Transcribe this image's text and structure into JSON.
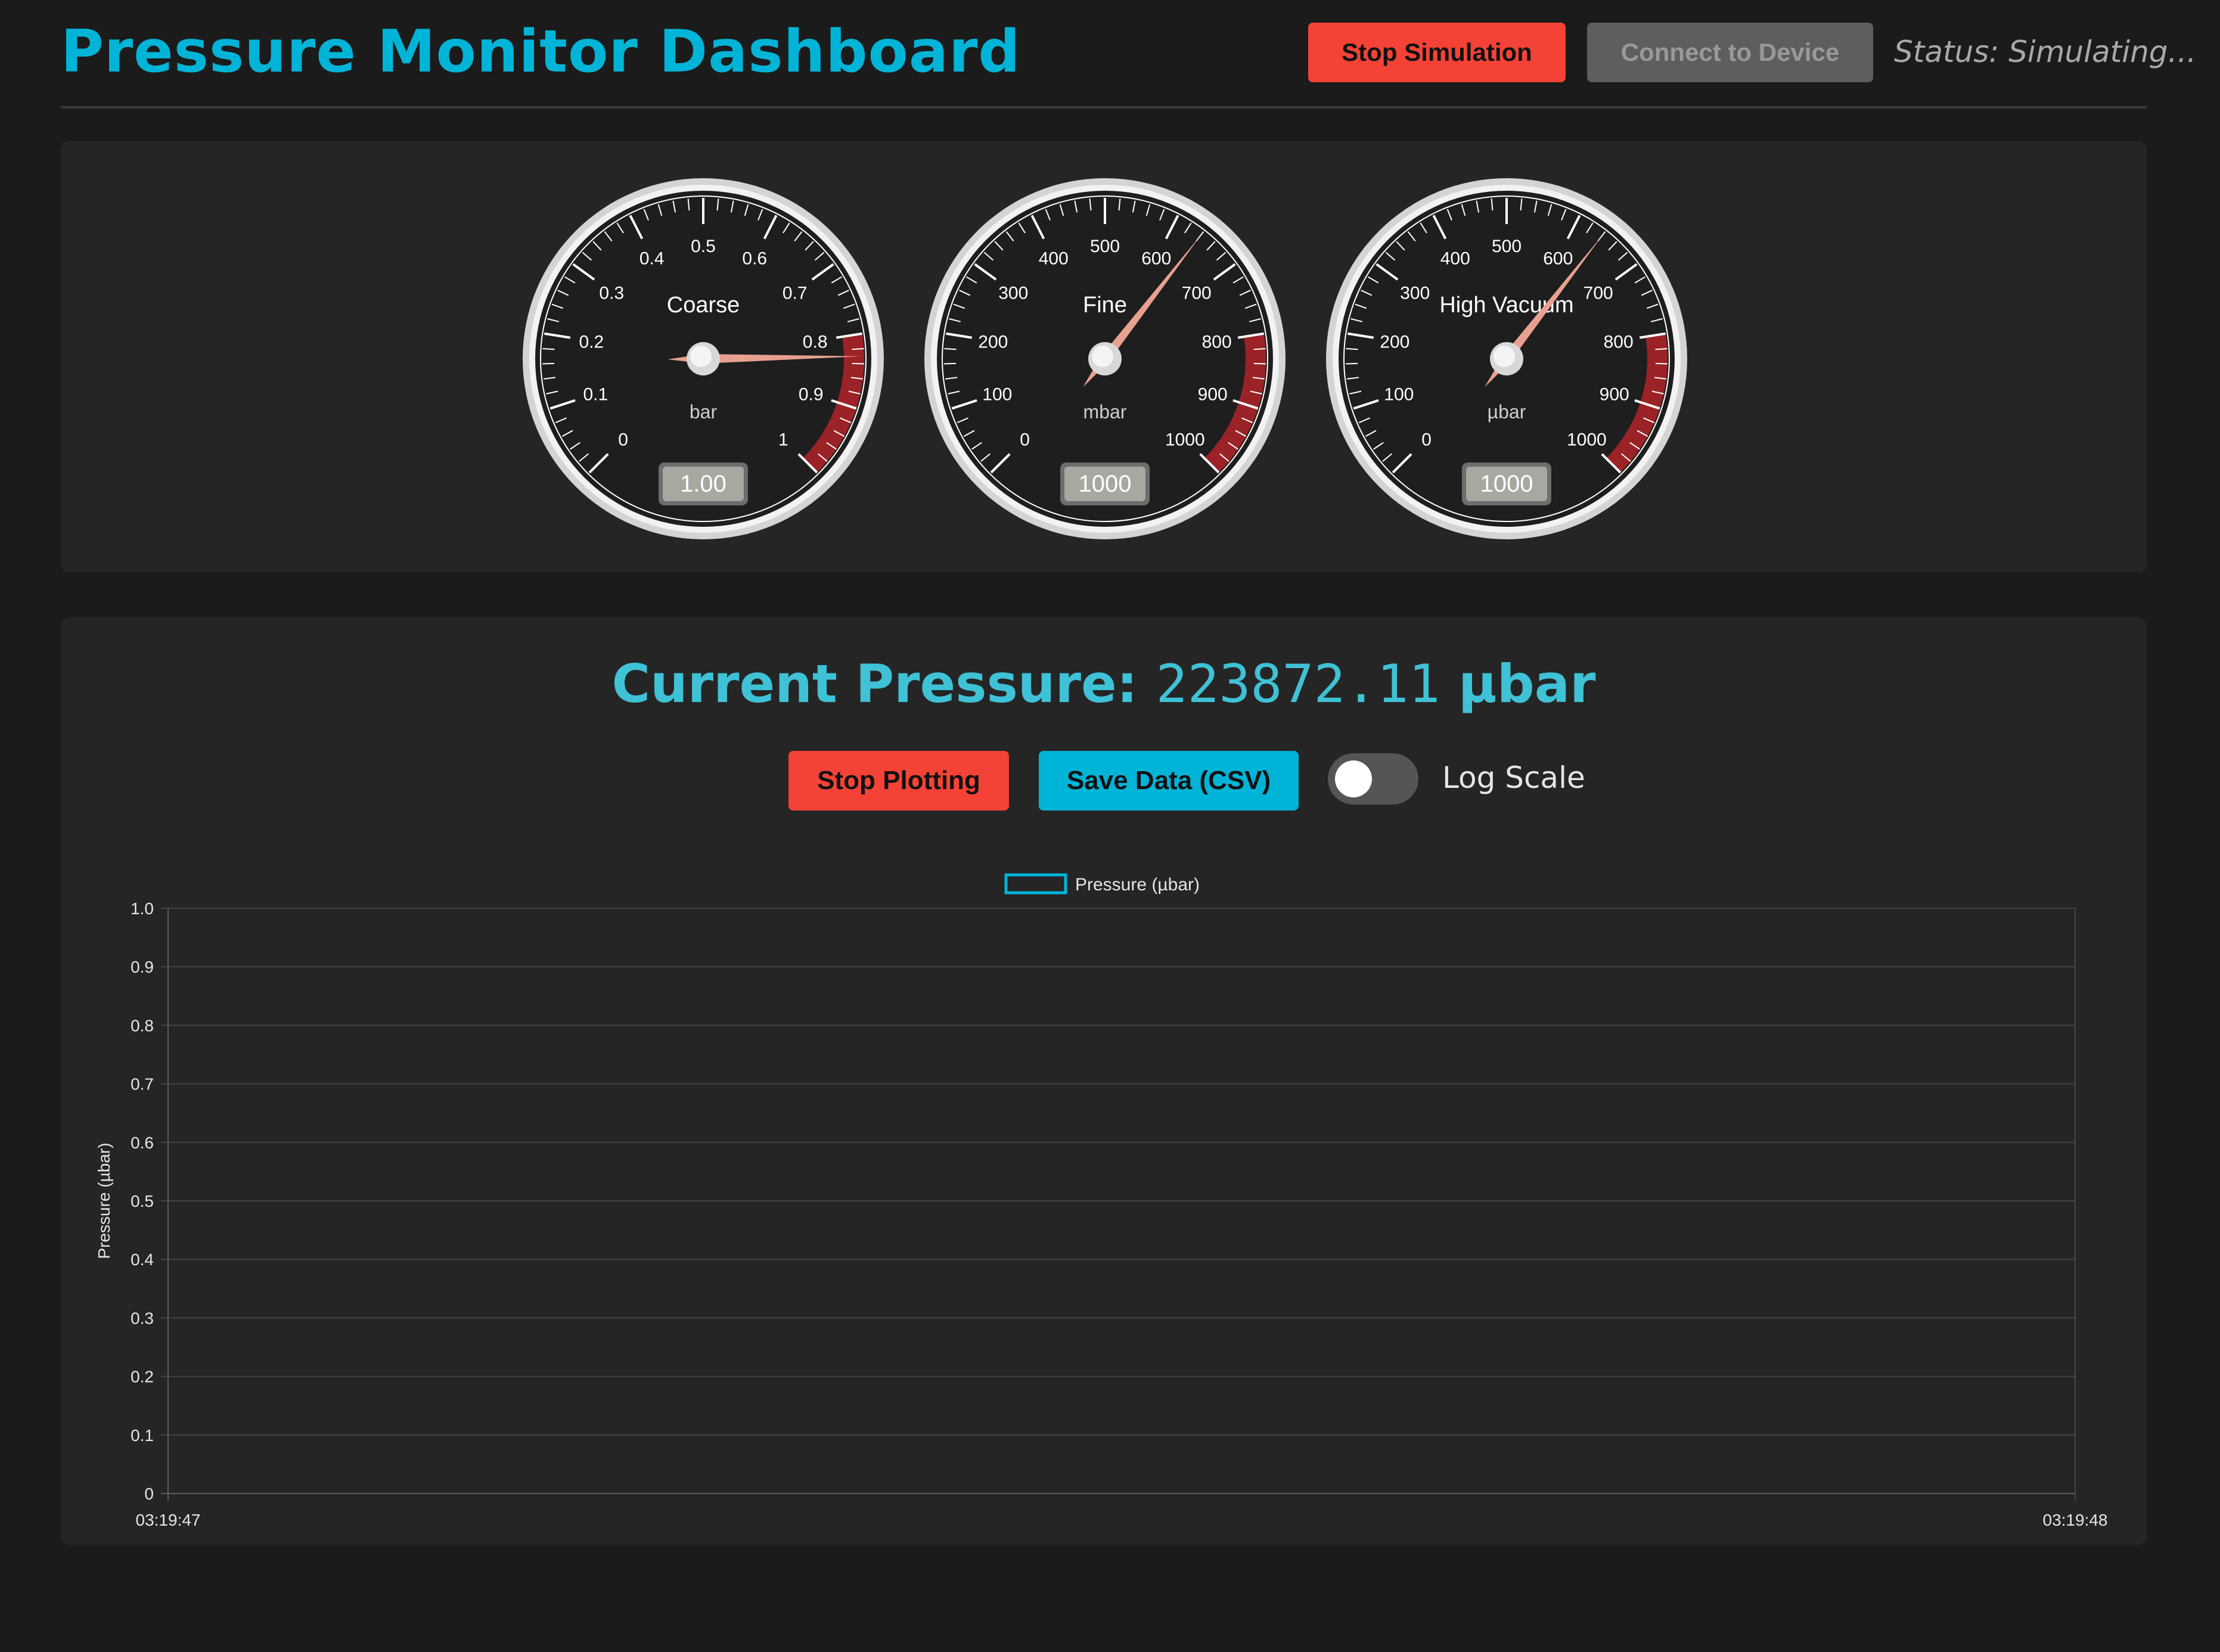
{
  "header": {
    "title": "Pressure Monitor Dashboard",
    "stop_simulation_label": "Stop Simulation",
    "connect_label": "Connect to Device",
    "status": "Status: Simulating..."
  },
  "gauges": [
    {
      "title": "Coarse",
      "unit": "bar",
      "display": "1.00",
      "ticks": [
        "0",
        "0.1",
        "0.2",
        "0.3",
        "0.4",
        "0.5",
        "0.6",
        "0.7",
        "0.8",
        "0.9",
        "1"
      ],
      "max": 1,
      "needle_value": 0.83
    },
    {
      "title": "Fine",
      "unit": "mbar",
      "display": "1000",
      "ticks": [
        "0",
        "100",
        "200",
        "300",
        "400",
        "500",
        "600",
        "700",
        "800",
        "900",
        "1000"
      ],
      "max": 1000,
      "needle_value": 640
    },
    {
      "title": "High Vacuum",
      "unit": "µbar",
      "display": "1000",
      "ticks": [
        "0",
        "100",
        "200",
        "300",
        "400",
        "500",
        "600",
        "700",
        "800",
        "900",
        "1000"
      ],
      "max": 1000,
      "needle_value": 640
    }
  ],
  "colors": {
    "accent": "#00b4d8",
    "danger": "#f44336",
    "redzone": "#9b2226",
    "needle": "#e8a090"
  },
  "pressure_panel": {
    "label": "Current Pressure:",
    "value": "223872.11",
    "unit": "µbar",
    "stop_plotting_label": "Stop Plotting",
    "save_label": "Save Data (CSV)",
    "log_scale_label": "Log Scale",
    "log_scale_on": false
  },
  "chart_data": {
    "type": "line",
    "series": [
      {
        "name": "Pressure (µbar)",
        "values": []
      }
    ],
    "x": [
      "03:19:47",
      "03:19:48"
    ],
    "ylabel": "Pressure (µbar)",
    "yticks": [
      "0",
      "0.1",
      "0.2",
      "0.3",
      "0.4",
      "0.5",
      "0.6",
      "0.7",
      "0.8",
      "0.9",
      "1.0"
    ],
    "ylim": [
      0,
      1
    ],
    "grid": true,
    "legend": "top-center"
  }
}
